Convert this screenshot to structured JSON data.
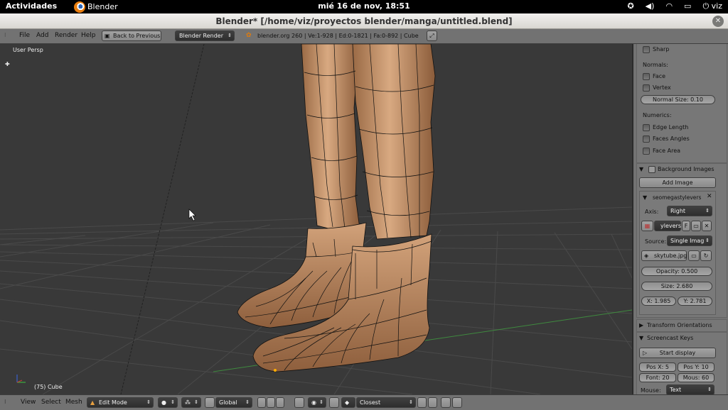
{
  "system_bar": {
    "activities": "Actividades",
    "app": "Blender",
    "clock": "mié 16 de nov, 18:51",
    "user": "viz"
  },
  "window": {
    "title": "Blender* [/home/viz/proyectos blender/manga/untitled.blend]"
  },
  "info_header": {
    "menus": [
      "File",
      "Add",
      "Render",
      "Help"
    ],
    "back_button": "Back to Previous",
    "engine": "Blender Render",
    "stats": "blender.org 260 | Ve:1-928 | Ed:0-1821 | Fa:0-892 | Cube"
  },
  "viewport": {
    "view_name": "User Persp",
    "object_label": "(75) Cube"
  },
  "properties": {
    "sharp": "Sharp",
    "normals_title": "Normals:",
    "face": "Face",
    "vertex": "Vertex",
    "normal_size": "Normal Size: 0.10",
    "numerics_title": "Numerics:",
    "edge_length": "Edge Length",
    "faces_angles": "Faces Angles",
    "face_area": "Face Area",
    "background_images": {
      "title": "Background Images",
      "add_image": "Add Image",
      "image_name": "seomegastylevers",
      "axis_label": "Axis:",
      "axis_value": "Right",
      "image_field": "ylevers",
      "fake_user": "F",
      "source_label": "Source:",
      "source_value": "Single Imag",
      "file": "skytube.jpg",
      "opacity": "Opacity: 0.500",
      "size": "Size: 2.680",
      "x": "X: 1.985",
      "y": "Y: 2.781"
    },
    "transform_orientations": "Transform Orientations",
    "screencast": {
      "title": "Screencast Keys",
      "start": "Start display",
      "pos_x": "Pos X: 5",
      "pos_y": "Pos Y: 10",
      "font": "Font: 20",
      "mous": "Mous: 60",
      "mouse_label": "Mouse:",
      "mouse_value": "Text"
    }
  },
  "bottom_header": {
    "menus": [
      "View",
      "Select",
      "Mesh"
    ],
    "mode": "Edit Mode",
    "orientation": "Global",
    "snap": "Closest"
  }
}
